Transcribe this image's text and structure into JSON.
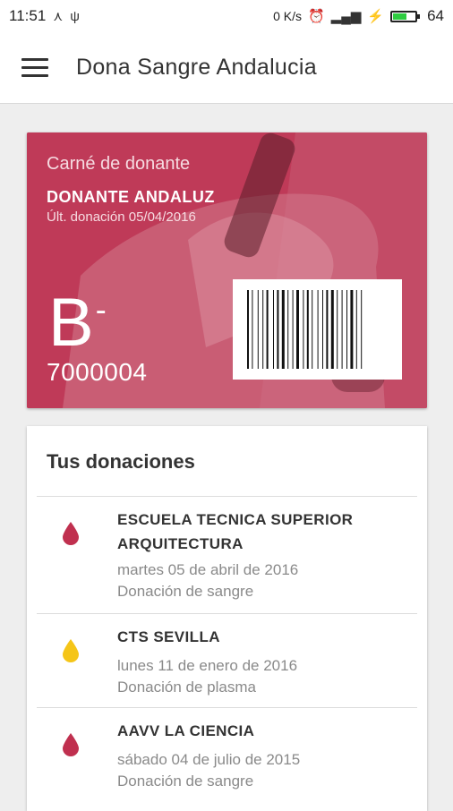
{
  "status_bar": {
    "time": "11:51",
    "data_speed": "0 K/s",
    "battery_level": "64",
    "battery_fraction": 0.64,
    "battery_color": "#2ecc40"
  },
  "app_bar": {
    "title": "Dona Sangre Andalucia"
  },
  "donor_card": {
    "label": "Carné de donante",
    "name": "DONANTE ANDALUZ",
    "last_donation": "Últ. donación 05/04/2016",
    "blood_group": "B",
    "rh": "-",
    "donor_number": "7000004",
    "card_color": "#bf3a58"
  },
  "donations": {
    "title": "Tus donaciones",
    "items": [
      {
        "place_line1": "ESCUELA TECNICA SUPERIOR",
        "place_line2": "ARQUITECTURA",
        "date": "martes 05 de abril de 2016",
        "type": "Donación de sangre",
        "drop_color": "#c0304f"
      },
      {
        "place_line1": "CTS SEVILLA",
        "date": "lunes 11 de enero de 2016",
        "type": "Donación de plasma",
        "drop_color": "#f5c518"
      },
      {
        "place_line1": "AAVV LA CIENCIA",
        "date": "sábado 04 de julio de 2015",
        "type": "Donación de sangre",
        "drop_color": "#c0304f"
      }
    ]
  }
}
